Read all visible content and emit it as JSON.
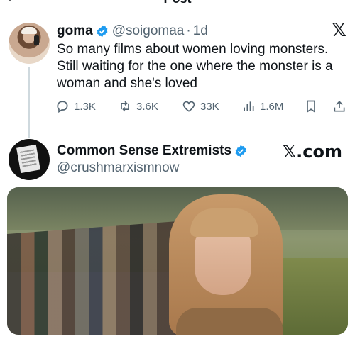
{
  "header": {
    "back_icon": "arrow-left-icon",
    "title": "Post"
  },
  "tweet1": {
    "display_name": "goma",
    "handle": "@soigomaa",
    "separator": "·",
    "time": "1d",
    "text": "So many films about women loving monsters. Still waiting for the one where the monster is a woman and she's loved",
    "brand_icon": "x-logo-icon",
    "brand_label": "𝕏",
    "stats": {
      "replies": "1.3K",
      "reposts": "3.6K",
      "likes": "33K",
      "views": "1.6M"
    },
    "verified_color": "#1d9bf0"
  },
  "tweet2": {
    "display_name": "Common Sense Extremists",
    "handle": "@crushmarxismnow",
    "brand_label": "𝕏.com",
    "verified_color": "#1d9bf0"
  },
  "colors": {
    "text": "#0f1419",
    "muted": "#536471",
    "accent": "#1d9bf0"
  }
}
